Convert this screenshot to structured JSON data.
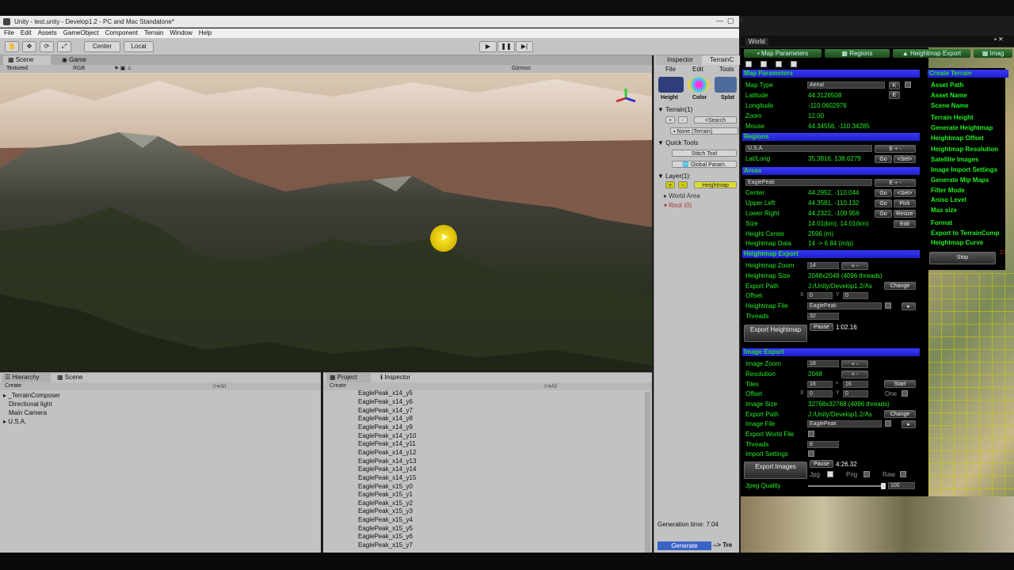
{
  "window": {
    "title": "Unity - test.unity - Develop1.2 - PC and Mac Standalone*"
  },
  "menu": [
    "File",
    "Edit",
    "Assets",
    "GameObject",
    "Component",
    "Terrain",
    "Window",
    "Help"
  ],
  "toolbar": {
    "pivot": "Center",
    "space": "Local"
  },
  "scene_tabs": {
    "scene": "Scene",
    "game": "Game"
  },
  "scene_bar": {
    "mode": "Textured",
    "color": "RGB",
    "gizmos": "Gizmos"
  },
  "inspector": {
    "tab1": "Inspector",
    "tab2": "TerrainC",
    "file": "File",
    "edit": "Edit",
    "tools": "Tools",
    "icons": [
      "Height",
      "Color",
      "Splat"
    ],
    "terrain_label": "Terrain(1)",
    "search": "Search",
    "none_terrain": "None (Terrain)",
    "quick_tools": "Quick Tools",
    "stitch_tool": "Stitch Tool",
    "global_param": "Global Param.",
    "layer_label": "Layer(1):",
    "heightmap": "Heightmap",
    "world_area": "World Area",
    "root": "Root (0)",
    "generation_time": "Generation time: 7.04",
    "generate": "Generate",
    "arrow_label": "--> Tre"
  },
  "hierarchy": {
    "tab": "Hierarchy",
    "tab2": "Scene",
    "create": "Create",
    "search": "All",
    "items": [
      "_TerrainComposer",
      "Directional light",
      "Main Camera",
      "U.S.A."
    ]
  },
  "project": {
    "tab": "Project",
    "tab2": "Inspector",
    "create": "Create",
    "search": "All",
    "files": [
      "EaglePeak_x14_y5",
      "EaglePeak_x14_y6",
      "EaglePeak_x14_y7",
      "EaglePeak_x14_y8",
      "EaglePeak_x14_y9",
      "EaglePeak_x14_y10",
      "EaglePeak_x14_y11",
      "EaglePeak_x14_y12",
      "EaglePeak_x14_y13",
      "EaglePeak_x14_y14",
      "EaglePeak_x14_y15",
      "EaglePeak_x15_y0",
      "EaglePeak_x15_y1",
      "EaglePeak_x15_y2",
      "EaglePeak_x15_y3",
      "EaglePeak_x15_y4",
      "EaglePeak_x15_y5",
      "EaglePeak_x15_y6",
      "EaglePeak_x15_y7"
    ]
  },
  "world": {
    "title": "World",
    "tabs": [
      "Map Parameters",
      "Regions",
      "Heightmap Export",
      "Imag"
    ],
    "map_params": {
      "header": "Map Parameters",
      "map_type_label": "Map Type",
      "map_type": "Aerial",
      "k_btn": "K",
      "latitude_label": "Latitude",
      "latitude": "44.3126508",
      "e_btn": "E",
      "longitude_label": "Longitude",
      "longitude": "-110.0602976",
      "zoom_label": "Zoom",
      "zoom": "12.00",
      "mouse_label": "Mouse",
      "mouse": "44.34556, -110.34285"
    },
    "regions": {
      "header": "Regions",
      "region": "U.S.A.",
      "latlong_label": "Lat/Long",
      "latlong": "35.3816, 138.6279",
      "go": "Go",
      "set": "<Set>"
    },
    "areas": {
      "header": "Areas",
      "area": "EaglePeak",
      "center_label": "Center",
      "center": "44.2952, -110.044",
      "upper_left_label": "Upper Left",
      "upper_left": "44.3581, -110.132",
      "pick": "Pick",
      "lower_right_label": "Lower Right",
      "lower_right": "44.2322, -109.956",
      "resize": "Resize",
      "size_label": "Size",
      "size": "14.01(km), 14.01(km)",
      "edit": "Edit",
      "height_center_label": "Height Center",
      "height_center": "2596 (m)",
      "heightmap_data_label": "Heightmap Data",
      "heightmap_data": "14 -> 6.84 (m/p)"
    },
    "heightmap_export": {
      "header": "Heightmap Export",
      "zoom_label": "Heightmap Zoom",
      "zoom": "14",
      "size_label": "Heightmap Size",
      "size": "2048x2048  (4096 threads)",
      "path_label": "Export Path",
      "path": "J:/Unity/Develop1.2/As",
      "change": "Change",
      "offset_label": "Offset",
      "x": "X",
      "y": "Y",
      "ox": "0",
      "oy": "0",
      "file_label": "Heightmap File",
      "file": "EaglePeak",
      "threads_label": "Threads",
      "threads": "32",
      "pause": "Pause",
      "time": "1:02.16",
      "export_btn": "Export Heightmap"
    },
    "image_export": {
      "header": "Image Export",
      "zoom_label": "Image Zoom",
      "zoom": "18",
      "resolution_label": "Resolution",
      "resolution": "2048",
      "tiles_label": "Tiles",
      "tiles_x": "16",
      "tiles_sep": "*",
      "tiles_y": "16",
      "start": "Start",
      "offset_label": "Offset",
      "x": "X",
      "y": "Y",
      "ox": "0",
      "oy": "0",
      "one": "One",
      "size_label": "Image Size",
      "size": "32768x32768  (4096 threads)",
      "path_label": "Export Path",
      "path": "J:/Unity/Develop1.2/As",
      "change": "Change",
      "file_label": "Image File",
      "file": "EaglePeak",
      "world_file_label": "Export World File",
      "threads_label": "Threads",
      "threads": "8",
      "import_label": "Import Settings",
      "pause": "Pause",
      "time": "4:26.32",
      "export_btn": "Export Images",
      "jpg": "Jpg",
      "png": "Png",
      "raw": "Raw",
      "jpeg_quality_label": "Jpeg Quality",
      "jpeg_quality": "100"
    },
    "create_terrain": {
      "header": "Create Terrain",
      "items": [
        "Asset Path",
        "Asset Name",
        "Scene Name",
        "Terrain Height",
        "Generate Heightmap",
        "Heightmap Offset",
        "Heightmap Resolution",
        "Satellite Images",
        "Image Import Settings",
        "Generate Mip Maps",
        "Filter Mode",
        "Aniso Level",
        "Max size",
        "Format",
        "Export to TerrainComp",
        "Heightmap Curve"
      ],
      "stop": "Stop",
      "side": "17"
    }
  },
  "colors": {
    "green": "#22ee22",
    "blue_header": "#2828e0"
  }
}
